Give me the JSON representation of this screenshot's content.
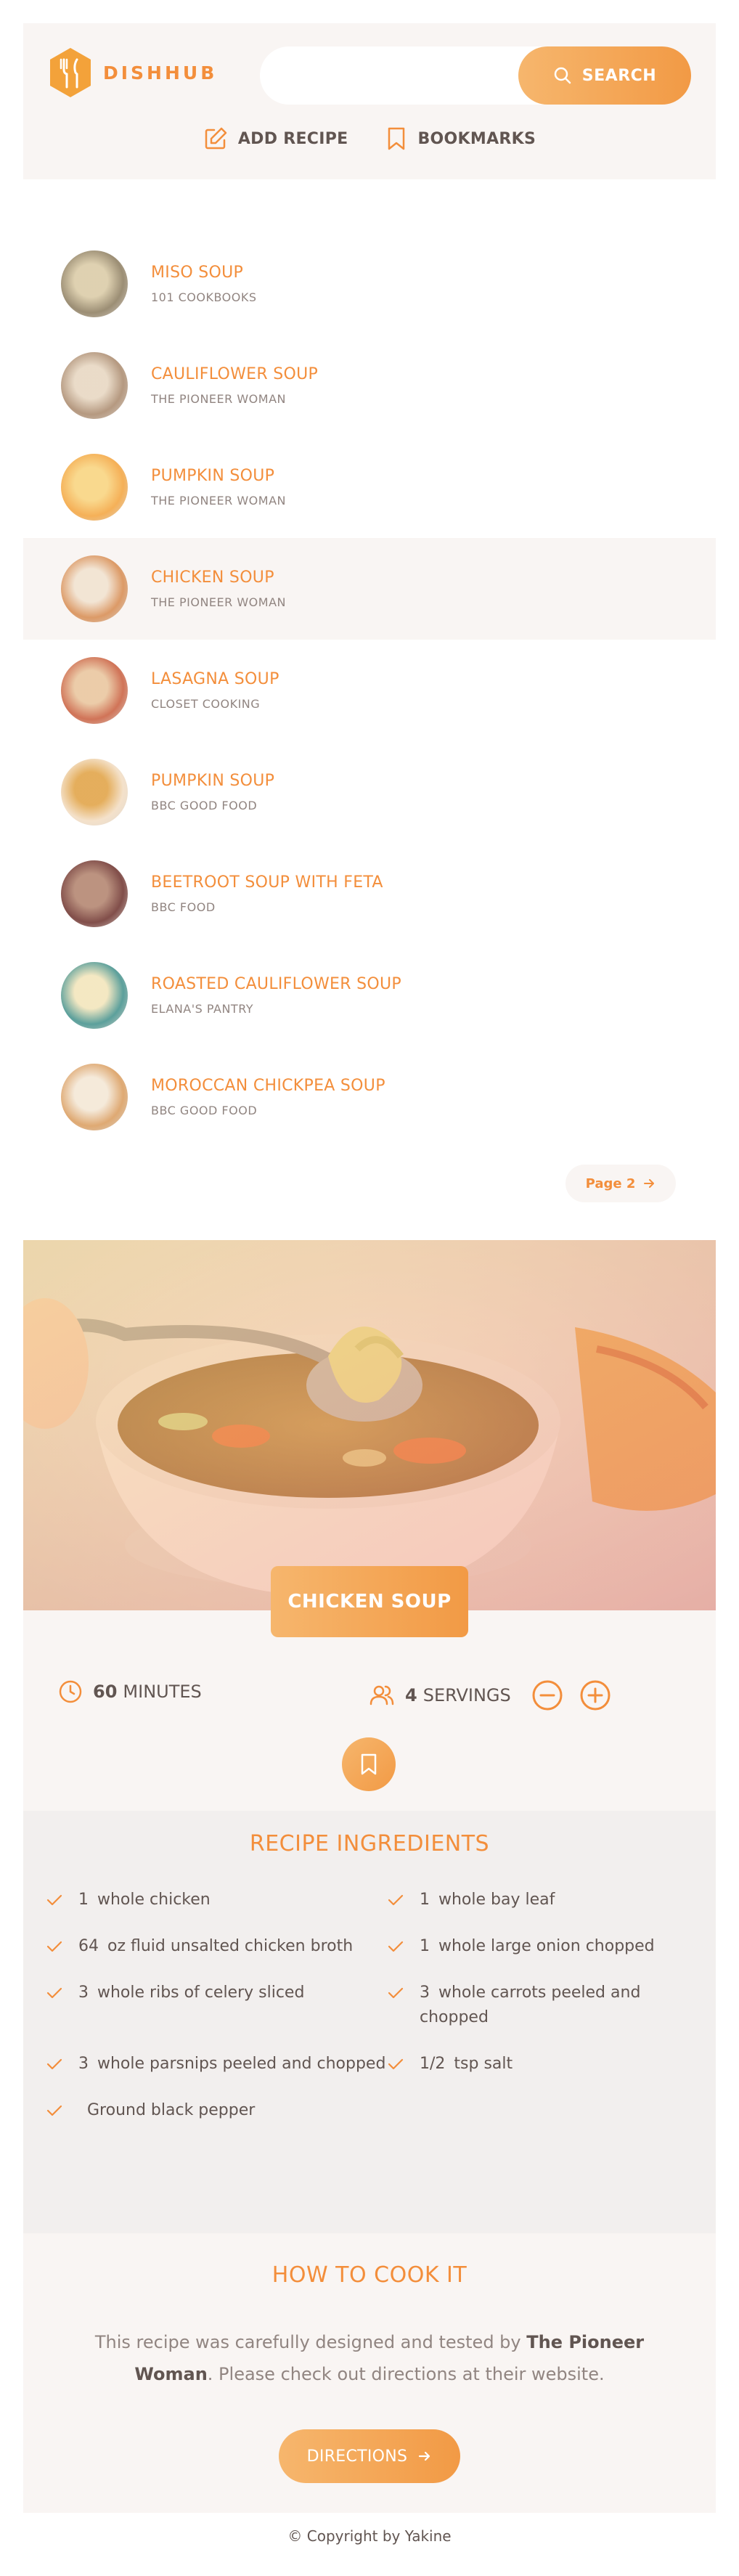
{
  "header": {
    "logo_text": "DISHHUB",
    "search": {
      "value": "",
      "placeholder": ""
    },
    "search_button_label": "SEARCH",
    "nav": {
      "add_recipe_label": "ADD RECIPE",
      "bookmarks_label": "BOOKMARKS"
    }
  },
  "results": {
    "items": [
      {
        "title": "MISO SOUP",
        "publisher": "101 COOKBOOKS",
        "thumb": [
          "#8a7a5c",
          "#d9c9a3"
        ],
        "active": false
      },
      {
        "title": "CAULIFLOWER SOUP",
        "publisher": "THE PIONEER WOMAN",
        "thumb": [
          "#a8876a",
          "#e6d5bf"
        ],
        "active": false
      },
      {
        "title": "PUMPKIN SOUP",
        "publisher": "THE PIONEER WOMAN",
        "thumb": [
          "#f3a23a",
          "#f8d27a"
        ],
        "active": false
      },
      {
        "title": "CHICKEN SOUP",
        "publisher": "THE PIONEER WOMAN",
        "thumb": [
          "#d78a4e",
          "#f1e2cf"
        ],
        "active": true
      },
      {
        "title": "LASAGNA SOUP",
        "publisher": "CLOSET COOKING",
        "thumb": [
          "#c85b3a",
          "#e8c39a"
        ],
        "active": false
      },
      {
        "title": "PUMPKIN SOUP",
        "publisher": "BBC GOOD FOOD",
        "thumb": [
          "#f2dcc1",
          "#e0a040"
        ],
        "active": false
      },
      {
        "title": "BEETROOT SOUP WITH FETA",
        "publisher": "BBC FOOD",
        "thumb": [
          "#6b2f2a",
          "#b0806a"
        ],
        "active": false
      },
      {
        "title": "ROASTED CAULIFLOWER SOUP",
        "publisher": "ELANA'S PANTRY",
        "thumb": [
          "#3f8f8a",
          "#f2e4b8"
        ],
        "active": false
      },
      {
        "title": "MOROCCAN CHICKPEA SOUP",
        "publisher": "BBC GOOD FOOD",
        "thumb": [
          "#d99a5a",
          "#f3e6d4"
        ],
        "active": false
      }
    ],
    "pagination_label": "Page 2"
  },
  "recipe": {
    "title": "CHICKEN SOUP",
    "cooking_time": "60",
    "cooking_time_unit": "MINUTES",
    "servings": "4",
    "servings_unit": "SERVINGS",
    "ingredients_heading": "RECIPE INGREDIENTS",
    "ingredients": [
      {
        "qty": "1",
        "text": "whole chicken"
      },
      {
        "qty": "1",
        "text": "whole bay leaf"
      },
      {
        "qty": "64",
        "text": "oz fluid unsalted chicken broth"
      },
      {
        "qty": "1",
        "text": "whole large onion chopped"
      },
      {
        "qty": "3",
        "text": "whole ribs of celery sliced"
      },
      {
        "qty": "3",
        "text": "whole carrots peeled and chopped"
      },
      {
        "qty": "3",
        "text": "whole parsnips peeled and chopped"
      },
      {
        "qty": "1/2",
        "text": "tsp salt"
      },
      {
        "qty": "",
        "text": "Ground black pepper"
      }
    ],
    "directions_heading": "HOW TO COOK IT",
    "directions_pre": "This recipe was carefully designed and tested by ",
    "directions_publisher": "The Pioneer Woman",
    "directions_post": ". Please check out directions at their website.",
    "directions_button_label": "DIRECTIONS"
  },
  "footer": {
    "copyright": "© Copyright by Yakine"
  },
  "colors": {
    "accent": "#f38e3b",
    "accent_light": "#f6b66d",
    "panel": "#f9f5f3",
    "text": "#615551",
    "muted": "#918581"
  }
}
